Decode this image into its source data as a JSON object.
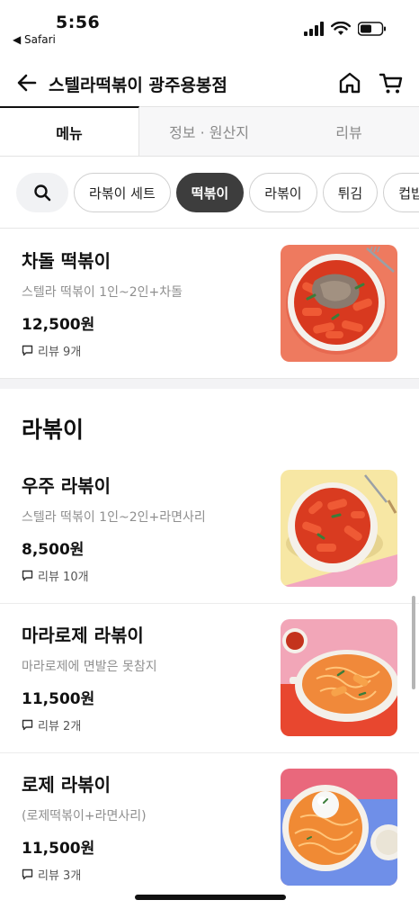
{
  "status_bar": {
    "time": "5:56",
    "back_app": "◀ Safari"
  },
  "header": {
    "title": "스텔라떡볶이 광주용봉점",
    "icons": [
      "back-arrow-icon",
      "home-icon",
      "cart-icon"
    ]
  },
  "tabs": [
    {
      "label": "메뉴",
      "active": true
    },
    {
      "label": "정보 · 원산지",
      "active": false
    },
    {
      "label": "리뷰",
      "active": false
    }
  ],
  "categories": {
    "search_icon": "search-icon",
    "items": [
      {
        "label": "라볶이 세트",
        "active": false
      },
      {
        "label": "떡볶이",
        "active": true
      },
      {
        "label": "라볶이",
        "active": false
      },
      {
        "label": "튀김",
        "active": false
      },
      {
        "label": "컵밥",
        "active": false
      }
    ]
  },
  "menu": {
    "item_0": {
      "name": "차돌 떡볶이",
      "desc": "스텔라 떡볶이 1인~2인+차돌",
      "price": "12,500원",
      "review": "리뷰 9개"
    },
    "section_title": "라볶이",
    "item_1": {
      "name": "우주 라볶이",
      "desc": "스텔라 떡볶이 1인~2인+라면사리",
      "price": "8,500원",
      "review": "리뷰 10개"
    },
    "item_2": {
      "name": "마라로제 라볶이",
      "desc": "마라로제에 면발은 못참지",
      "price": "11,500원",
      "review": "리뷰 2개"
    },
    "item_3": {
      "name": "로제 라볶이",
      "desc": "(로제떡볶이+라면사리)",
      "price": "11,500원",
      "review": "리뷰 3개"
    }
  },
  "colors": {
    "active_chip": "#3d3d3d",
    "photo_bg_1": "#ee7a5f",
    "photo_bg_2": "#f7e7a4",
    "photo_bg_3": "#f2a6b8",
    "photo_bg_4": "#6f8fe8"
  }
}
